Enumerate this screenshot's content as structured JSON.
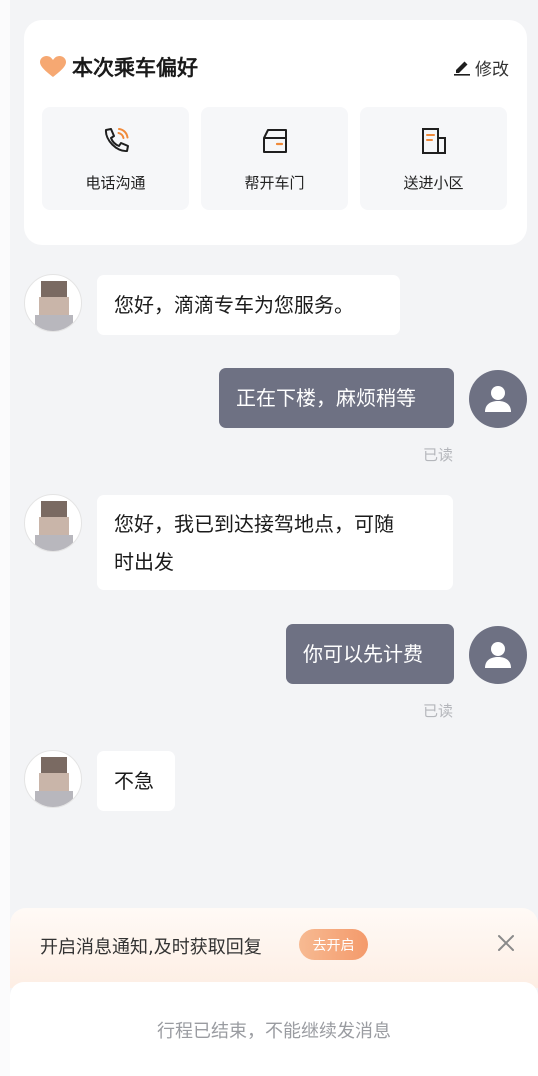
{
  "preferences": {
    "title": "本次乘车偏好",
    "edit_label": "修改",
    "items": [
      {
        "label": "电话沟通",
        "icon": "phone-call-icon"
      },
      {
        "label": "帮开车门",
        "icon": "car-door-icon"
      },
      {
        "label": "送进小区",
        "icon": "building-icon"
      }
    ]
  },
  "messages": [
    {
      "from": "driver",
      "text": "您好，滴滴专车为您服务。"
    },
    {
      "from": "user",
      "text": "正在下楼，麻烦稍等",
      "status": "已读"
    },
    {
      "from": "driver",
      "text_line1": "您好，我已到达接驾地点，可随",
      "text_line2": "时出发"
    },
    {
      "from": "user",
      "text": "你可以先计费",
      "status": "已读"
    },
    {
      "from": "driver",
      "text": "不急"
    }
  ],
  "notification": {
    "text": "开启消息通知,及时获取回复",
    "button_label": "去开启"
  },
  "footer": {
    "text": "行程已结束，不能继续发消息"
  },
  "colors": {
    "accent": "#f08a3a",
    "user_bubble": "#6e7183",
    "background": "#f3f4f6"
  }
}
